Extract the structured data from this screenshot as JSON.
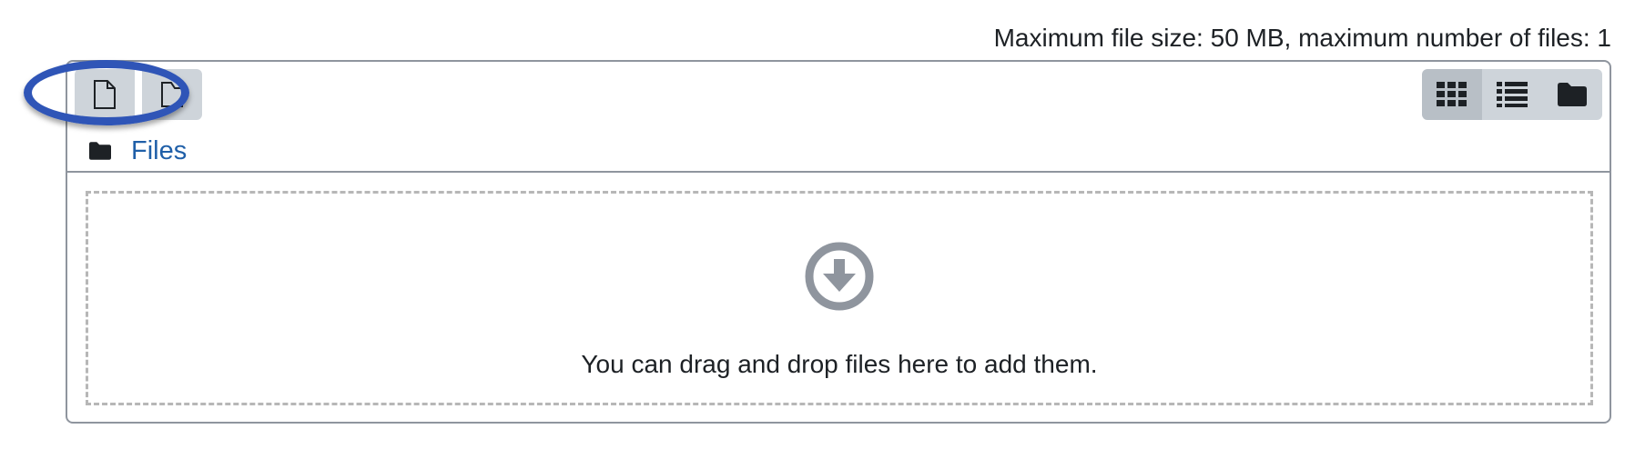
{
  "limits_text": "Maximum file size: 50 MB, maximum number of files: 1",
  "toolbar": {
    "left_buttons": [
      {
        "name": "add-file",
        "icon": "file-icon"
      },
      {
        "name": "create-folder",
        "icon": "folder-outline-icon"
      }
    ],
    "view_buttons": [
      {
        "name": "view-icons",
        "icon": "grid-icon",
        "active": true
      },
      {
        "name": "view-list",
        "icon": "list-icon",
        "active": false
      },
      {
        "name": "view-tree",
        "icon": "folder-icon",
        "active": false
      }
    ]
  },
  "breadcrumb": {
    "icon": "folder-icon",
    "label": "Files"
  },
  "dropzone": {
    "icon": "arrow-circle-down-icon",
    "message": "You can drag and drop files here to add them."
  },
  "colors": {
    "link": "#1f5fa8",
    "button_bg": "#ced4da",
    "button_active_bg": "#b8bfc6",
    "border": "#8f959e",
    "dashed_border": "#b7b7b7",
    "highlight": "#2f55b7",
    "drop_icon": "#8f959e"
  }
}
